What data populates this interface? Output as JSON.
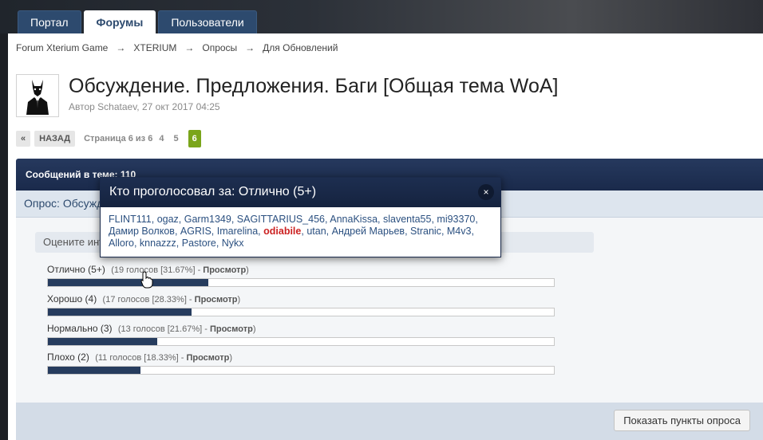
{
  "nav": {
    "tabs": [
      {
        "label": "Портал"
      },
      {
        "label": "Форумы"
      },
      {
        "label": "Пользователи"
      }
    ]
  },
  "breadcrumb": [
    "Forum Xterium Game",
    "XTERIUM",
    "Опросы",
    "Для Обновлений"
  ],
  "breadcrumb_sep": "→",
  "topic": {
    "title": "Обсуждение. Предложения. Баги [Общая тема WoA]",
    "meta": "Автор Schataev, 27 окт 2017 04:25"
  },
  "pagination": {
    "prev_symbol": "«",
    "back_label": "НАЗАД",
    "page_info": "Страница 6 из 6",
    "pages": [
      "4",
      "5"
    ],
    "current": "6"
  },
  "topicbar": {
    "text": "Сообщений в теме: 110"
  },
  "poll": {
    "header": "Опрос: Обсуждение",
    "rate_label": "Оцените интерфейс",
    "view_label": "Просмотр",
    "options": [
      {
        "label": "Отлично (5+)",
        "count": "(19 голосов [31.67%] -",
        "percent": 31.67
      },
      {
        "label": "Хорошо (4)",
        "count": "(17 голосов [28.33%] -",
        "percent": 28.33
      },
      {
        "label": "Нормально (3)",
        "count": "(13 голосов [21.67%] -",
        "percent": 21.67
      },
      {
        "label": "Плохо (2)",
        "count": "(11 голосов [18.33%] -",
        "percent": 18.33
      }
    ],
    "show_button": "Показать пункты опроса"
  },
  "popup": {
    "title": "Кто проголосовал за: Отлично (5+)",
    "close": "×",
    "voters": [
      "FLINT111",
      "ogaz",
      "Garm1349",
      "SAGITTARIUS_456",
      "AnnaKissa",
      "slaventa55",
      "mi93370",
      "Дамир Волков",
      "AGRIS",
      "Imarelina",
      "odiabile",
      "utan",
      "Андрей Марьев",
      "Stranic",
      "M4v3",
      "Alloro",
      "knnazzz",
      "Pastore",
      "Nykx"
    ],
    "highlighted_voter": "odiabile"
  }
}
